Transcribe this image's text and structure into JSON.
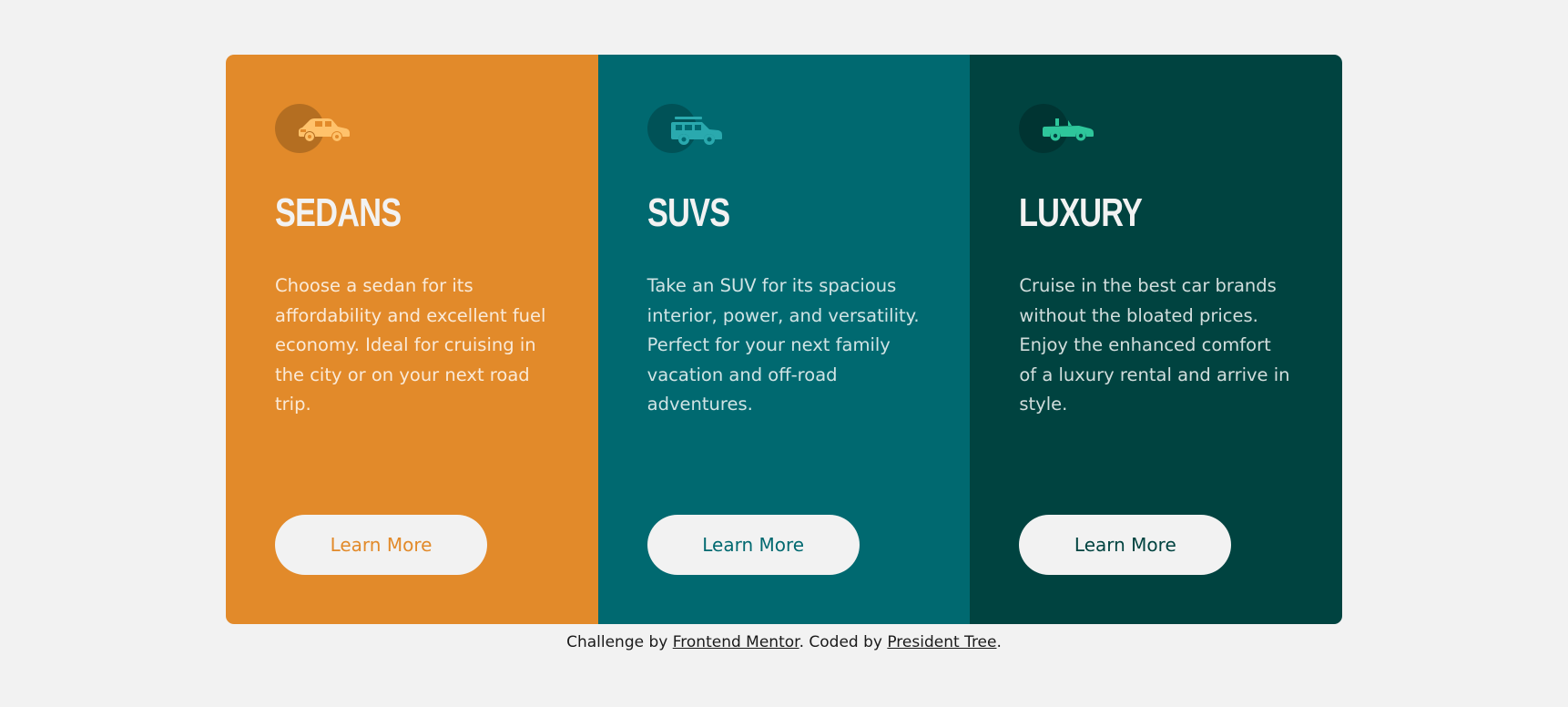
{
  "colors": {
    "background": "#f2f2f2",
    "sedans": "#e28a2a",
    "suvs": "#006970",
    "luxury": "#004340",
    "button_bg": "#f2f2f2",
    "sedan_icon": "#ffc26b",
    "suv_icon": "#2aa9ae",
    "luxury_icon": "#2ec69b"
  },
  "cards": [
    {
      "id": "sedans",
      "icon": "sedan-car-icon",
      "title": "SEDANS",
      "description": "Choose a sedan for its affordability and excellent fuel economy. Ideal for cruising in the city or on your next road trip.",
      "button_label": "Learn More"
    },
    {
      "id": "suvs",
      "icon": "suv-car-icon",
      "title": "SUVS",
      "description": "Take an SUV for its spacious interior, power, and versatility. Perfect for your next family vacation and off-road adventures.",
      "button_label": "Learn More"
    },
    {
      "id": "luxury",
      "icon": "convertible-car-icon",
      "title": "LUXURY",
      "description": "Cruise in the best car brands without the bloated prices. Enjoy the enhanced comfort of a luxury rental and arrive in style.",
      "button_label": "Learn More"
    }
  ],
  "attribution": {
    "prefix": "Challenge by ",
    "link1": "Frontend Mentor",
    "middle": ". Coded by ",
    "link2": "President Tree",
    "suffix": "."
  }
}
